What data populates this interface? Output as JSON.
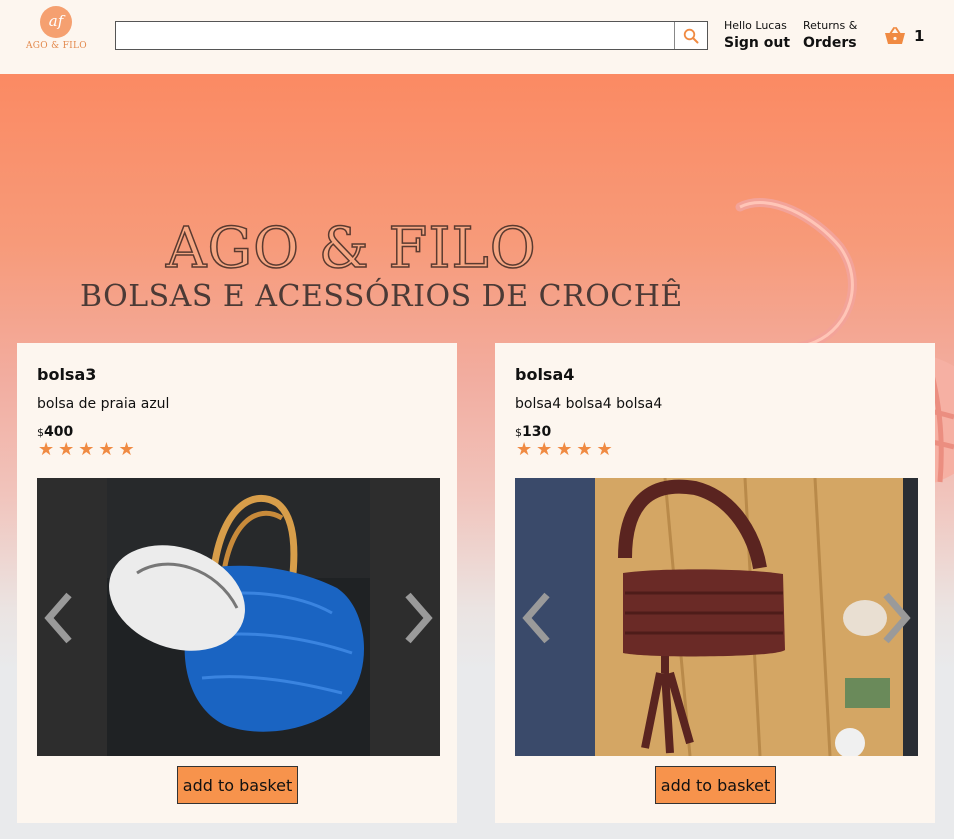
{
  "header": {
    "logo_mark": "af",
    "logo_text": "AGO & FILO",
    "search": {
      "value": "",
      "placeholder": ""
    },
    "account": {
      "greeting": "Hello Lucas",
      "action": "Sign out"
    },
    "orders": {
      "line1": "Returns &",
      "line2": "Orders"
    },
    "basket": {
      "count": "1"
    }
  },
  "hero": {
    "title": "AGO & FILO",
    "subtitle": "BOLSAS E ACESSÓRIOS DE CROCHÊ"
  },
  "products": [
    {
      "name": "bolsa3",
      "description": "bolsa de praia azul",
      "currency": "$",
      "price": "400",
      "rating": 5,
      "stars": "★★★★★",
      "button": "add to basket",
      "image": "blue crochet beach bag with white hat"
    },
    {
      "name": "bolsa4",
      "description": "bolsa4 bolsa4 bolsa4",
      "currency": "$",
      "price": "130",
      "rating": 5,
      "stars": "★★★★★",
      "button": "add to basket",
      "image": "brown crochet handbag with tassel on wooden table"
    }
  ],
  "colors": {
    "accent": "#f7934c",
    "star": "#f08a42",
    "header_bg": "#fdf6ef",
    "hero_top": "#fb8a63"
  }
}
